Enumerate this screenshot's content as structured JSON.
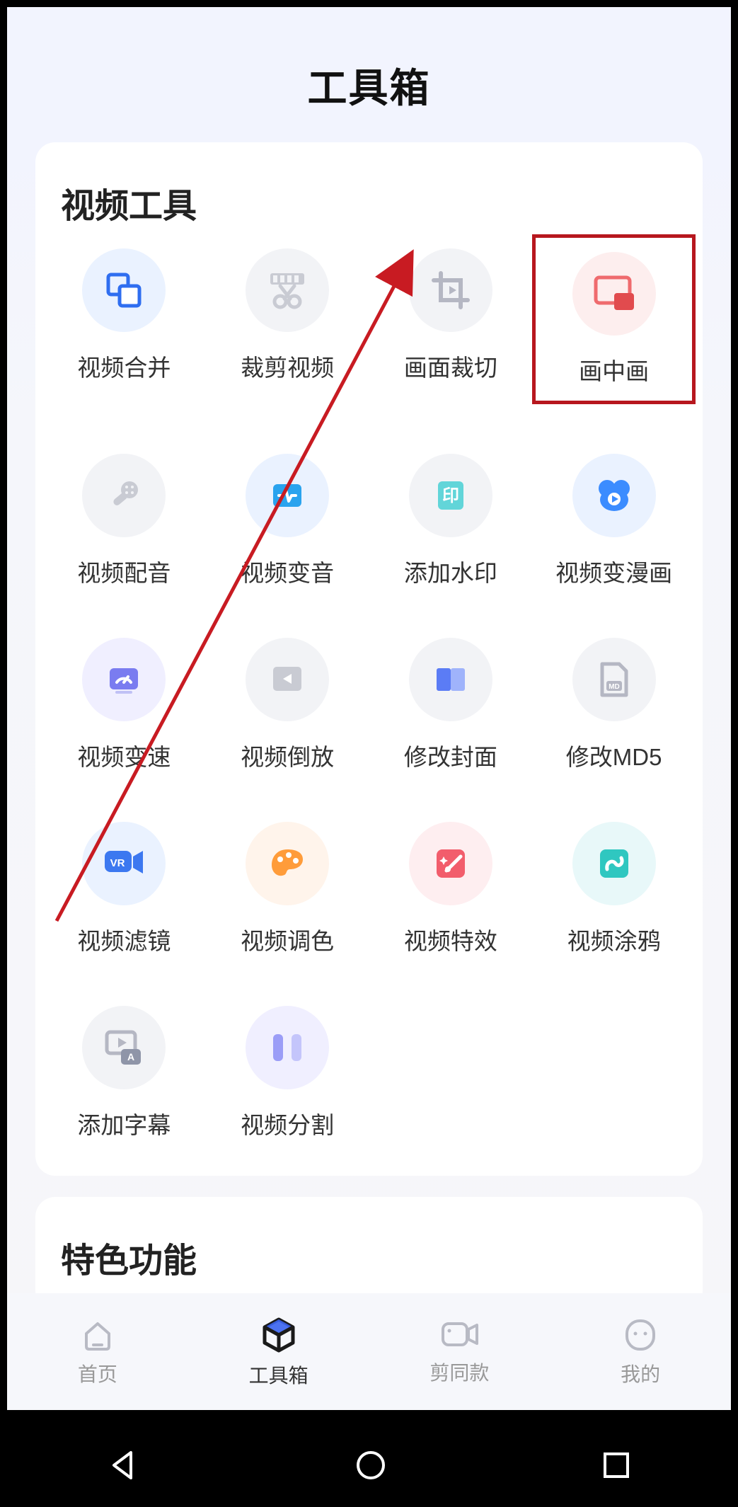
{
  "header": {
    "title": "工具箱"
  },
  "video_tools": {
    "heading": "视频工具",
    "items": [
      {
        "label": "视频合并",
        "icon": "merge-icon"
      },
      {
        "label": "裁剪视频",
        "icon": "cut-icon"
      },
      {
        "label": "画面裁切",
        "icon": "crop-icon"
      },
      {
        "label": "画中画",
        "icon": "pip-icon",
        "highlighted": true
      },
      {
        "label": "视频配音",
        "icon": "dub-icon"
      },
      {
        "label": "视频变音",
        "icon": "pitch-icon"
      },
      {
        "label": "添加水印",
        "icon": "watermark-icon"
      },
      {
        "label": "视频变漫画",
        "icon": "anime-icon"
      },
      {
        "label": "视频变速",
        "icon": "speed-icon"
      },
      {
        "label": "视频倒放",
        "icon": "reverse-icon"
      },
      {
        "label": "修改封面",
        "icon": "cover-icon"
      },
      {
        "label": "修改MD5",
        "icon": "md5-icon"
      },
      {
        "label": "视频滤镜",
        "icon": "filter-icon"
      },
      {
        "label": "视频调色",
        "icon": "color-icon"
      },
      {
        "label": "视频特效",
        "icon": "fx-icon"
      },
      {
        "label": "视频涂鸦",
        "icon": "doodle-icon"
      },
      {
        "label": "添加字幕",
        "icon": "subtitle-icon"
      },
      {
        "label": "视频分割",
        "icon": "split-icon"
      }
    ]
  },
  "featured": {
    "heading": "特色功能"
  },
  "nav": {
    "items": [
      {
        "label": "首页",
        "icon": "home-icon",
        "active": false
      },
      {
        "label": "工具箱",
        "icon": "toolbox-icon",
        "active": true
      },
      {
        "label": "剪同款",
        "icon": "template-icon",
        "active": false
      },
      {
        "label": "我的",
        "icon": "mine-icon",
        "active": false
      }
    ]
  }
}
